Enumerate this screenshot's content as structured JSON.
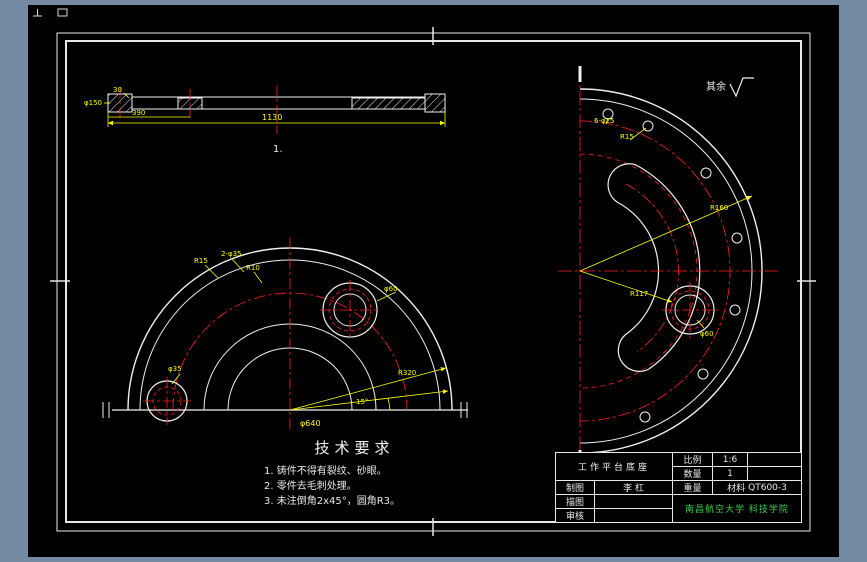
{
  "title_block": {
    "part_name": "工作平台底座",
    "scale_label": "比例",
    "scale_value": "1:6",
    "qty_label": "数量",
    "qty_value": "1",
    "drafter_label": "制图",
    "drafter_name": "李 杠",
    "weight_label": "重量",
    "material_label": "材料",
    "material_value": "QT600-3",
    "tracer_label": "描图",
    "checker_label": "审核",
    "organization": "南昌航空大学 科技学院"
  },
  "tech_req": {
    "title": "技术要求",
    "items": [
      "1. 铸件不得有裂纹、砂眼。",
      "2. 零件去毛刺处理。",
      "3. 未注倒角2x45°，圆角R3。"
    ]
  },
  "surface": {
    "note": "其余"
  },
  "dims": {
    "section": {
      "length": "1130",
      "thickness": "30",
      "left_dia": "φ150",
      "sub_len": "390",
      "view_label": "1."
    },
    "front": {
      "radius": "R320",
      "bottom_dia": "φ640",
      "boss_dia": "φ60",
      "hole_dia": "φ35",
      "note1": "R15",
      "note2": "2-φ35",
      "note3": "R10",
      "angle": "15°"
    },
    "right": {
      "holes": "6-φ25",
      "fillet": "R15",
      "radius": "R160",
      "bolt_circle": "R117",
      "boss_dia": "φ60"
    }
  },
  "colors": {
    "outline": "#f0f0f0",
    "centerline": "#ff2020",
    "dimension": "#ffff00",
    "org_text": "#37d24a",
    "paper_margin": "#7489a2",
    "sheet": "#000000"
  }
}
